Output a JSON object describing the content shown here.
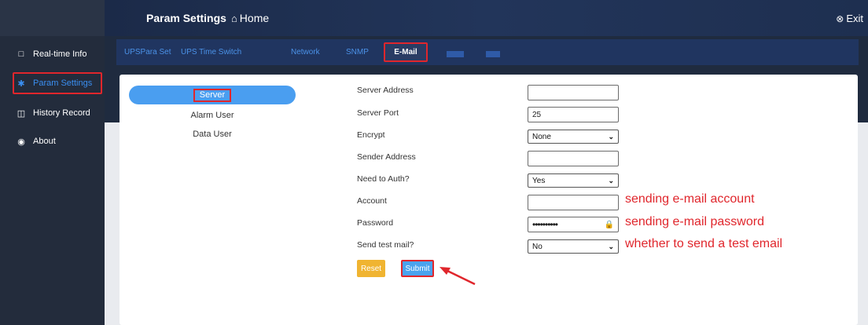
{
  "header": {
    "title": "Param Settings",
    "home_label": "Home",
    "home_icon": "home-icon",
    "exit_label": "Exit",
    "exit_icon": "exit-icon"
  },
  "sidebar": {
    "items": [
      {
        "label": "Real-time Info",
        "icon": "monitor-icon"
      },
      {
        "label": "Param Settings",
        "icon": "gear-icon"
      },
      {
        "label": "History Record",
        "icon": "history-icon"
      },
      {
        "label": "About",
        "icon": "about-icon"
      }
    ]
  },
  "tabs": {
    "items": [
      "UPSPara Set",
      "UPS Time Switch",
      "Network",
      "SNMP",
      "E-Mail"
    ],
    "active": "E-Mail"
  },
  "submenu": {
    "items": [
      "Server",
      "Alarm User",
      "Data User"
    ],
    "active": "Server"
  },
  "form": {
    "server_address": {
      "label": "Server Address",
      "value": ""
    },
    "server_port": {
      "label": "Server Port",
      "value": "25"
    },
    "encrypt": {
      "label": "Encrypt",
      "value": "None"
    },
    "sender_address": {
      "label": "Sender Address",
      "value": ""
    },
    "need_auth": {
      "label": "Need to Auth?",
      "value": "Yes"
    },
    "account": {
      "label": "Account",
      "value": ""
    },
    "password": {
      "label": "Password",
      "value": "••••••••••"
    },
    "send_test_mail": {
      "label": "Send test mail?",
      "value": "No"
    }
  },
  "buttons": {
    "reset": "Reset",
    "submit": "Submit"
  },
  "annotations": {
    "account": "sending e-mail account",
    "password": "sending e-mail password",
    "test_mail": "whether to send a test email"
  },
  "colors": {
    "accent": "#3a8ef0",
    "highlight": "#e0262c",
    "reset": "#f0b431",
    "submit": "#4aa3ee"
  }
}
